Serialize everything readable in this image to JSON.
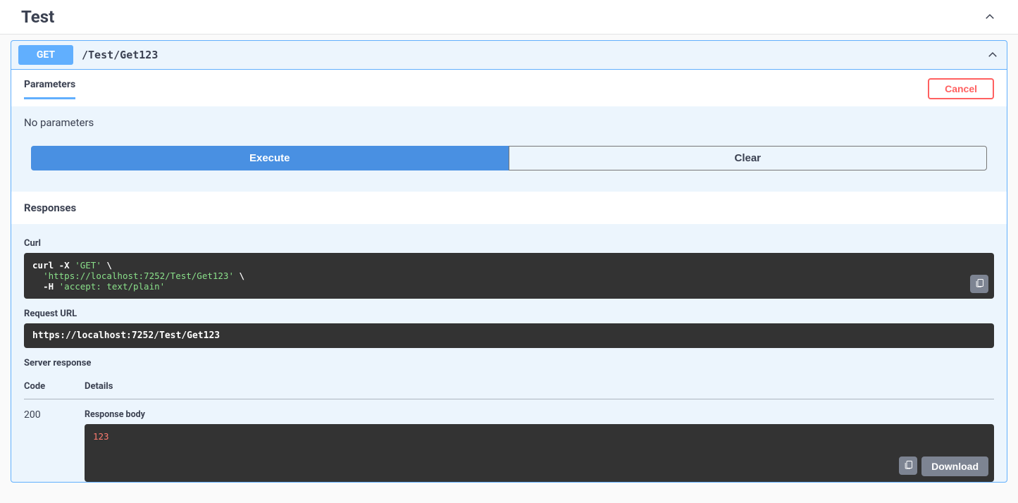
{
  "tag": {
    "title": "Test"
  },
  "operation": {
    "method": "GET",
    "path": "/Test/Get123"
  },
  "parameters": {
    "tab_label": "Parameters",
    "cancel_label": "Cancel",
    "empty_text": "No parameters"
  },
  "buttons": {
    "execute": "Execute",
    "clear": "Clear",
    "download": "Download"
  },
  "responses": {
    "header": "Responses",
    "curl_label": "Curl",
    "curl_cmd_prefix": "curl -X ",
    "curl_method": "'GET'",
    "curl_slash": " \\",
    "curl_url": "'https://localhost:7252/Test/Get123'",
    "curl_h_flag": "-H ",
    "curl_header": "'accept: text/plain'",
    "request_url_label": "Request URL",
    "request_url": "https://localhost:7252/Test/Get123",
    "server_response_label": "Server response",
    "col_code": "Code",
    "col_details": "Details",
    "status_code": "200",
    "response_body_label": "Response body",
    "response_body_value": "123"
  }
}
